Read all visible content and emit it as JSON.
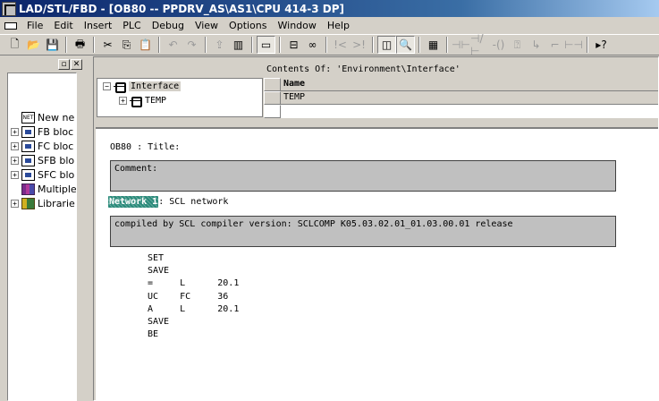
{
  "window": {
    "title": "LAD/STL/FBD  - [OB80 -- PPDRV_AS\\AS1\\CPU 414-3 DP]"
  },
  "menu": [
    "File",
    "Edit",
    "Insert",
    "PLC",
    "Debug",
    "View",
    "Options",
    "Window",
    "Help"
  ],
  "toolbar_icons": [
    "new-icon",
    "open-icon",
    "save-icon",
    "print-icon",
    "cut-icon",
    "copy-icon",
    "paste-icon",
    "undo-icon",
    "redo-icon",
    "load-icon",
    "monitor-icon",
    "overview-icon",
    "network-icon",
    "browse-icon",
    "jump-icon",
    "jump-back-icon",
    "details-icon",
    "zoom-icon",
    "instance-icon",
    "contact-no-icon",
    "contact-nc-icon",
    "coil-icon",
    "box-icon",
    "branch-open-icon",
    "branch-close-icon",
    "connector-icon",
    "help-icon"
  ],
  "left_tree": {
    "items": [
      {
        "label": "New ne",
        "expandable": false
      },
      {
        "label": "FB bloc",
        "expandable": true
      },
      {
        "label": "FC bloc",
        "expandable": true
      },
      {
        "label": "SFB blo",
        "expandable": true
      },
      {
        "label": "SFC blo",
        "expandable": true
      },
      {
        "label": "Multiple",
        "expandable": false
      },
      {
        "label": "Librarie",
        "expandable": true
      }
    ]
  },
  "interface": {
    "root_label": "Interface",
    "child_label": "TEMP"
  },
  "contents": {
    "label": "Contents Of: 'Environment\\Interface'",
    "column_name": "Name",
    "rows": [
      "TEMP"
    ]
  },
  "editor": {
    "title_line": "OB80 : Title:",
    "comment_label": "Comment:",
    "network_label": "Network 1",
    "network_title": ": SCL network",
    "network_comment": "compiled by SCL compiler version:  SCLCOMP K05.03.02.01_01.03.00.01 release",
    "code_lines": [
      "SET",
      "SAVE",
      "=     L      20.1",
      "UC    FC     36",
      "A     L      20.1",
      "SAVE",
      "BE"
    ]
  }
}
